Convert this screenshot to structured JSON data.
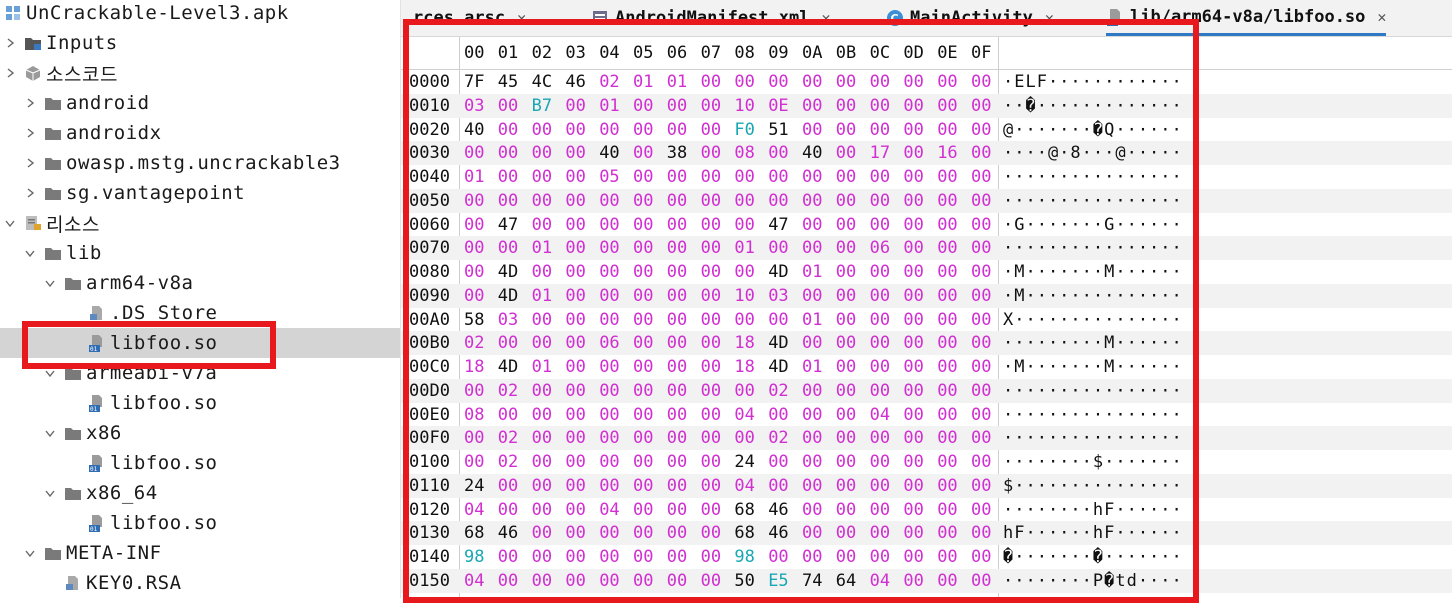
{
  "tree": {
    "items": [
      {
        "label": "UnCrackable-Level3.apk",
        "depth": 0,
        "chevron": "none",
        "icon": "apk-icon",
        "selected": false
      },
      {
        "label": "Inputs",
        "depth": 0,
        "chevron": "right",
        "icon": "inputs-folder-icon",
        "selected": false
      },
      {
        "label": "소스코드",
        "depth": 0,
        "chevron": "right",
        "icon": "source-package-icon",
        "selected": false
      },
      {
        "label": "android",
        "depth": 1,
        "chevron": "right",
        "icon": "package-folder-icon",
        "selected": false
      },
      {
        "label": "androidx",
        "depth": 1,
        "chevron": "right",
        "icon": "package-folder-icon",
        "selected": false
      },
      {
        "label": "owasp.mstg.uncrackable3",
        "depth": 1,
        "chevron": "right",
        "icon": "package-folder-icon",
        "selected": false
      },
      {
        "label": "sg.vantagepoint",
        "depth": 1,
        "chevron": "right",
        "icon": "package-folder-icon",
        "selected": false
      },
      {
        "label": "리소스",
        "depth": 0,
        "chevron": "down",
        "icon": "resources-icon",
        "selected": false
      },
      {
        "label": "lib",
        "depth": 1,
        "chevron": "down",
        "icon": "folder-icon",
        "selected": false
      },
      {
        "label": "arm64-v8a",
        "depth": 2,
        "chevron": "down",
        "icon": "folder-icon",
        "selected": false
      },
      {
        "label": ".DS_Store",
        "depth": 3,
        "chevron": "none",
        "icon": "file-icon",
        "selected": false
      },
      {
        "label": "libfoo.so",
        "depth": 3,
        "chevron": "none",
        "icon": "binary-file-icon",
        "selected": true
      },
      {
        "label": "armeabi-v7a",
        "depth": 2,
        "chevron": "down",
        "icon": "folder-icon",
        "selected": false
      },
      {
        "label": "libfoo.so",
        "depth": 3,
        "chevron": "none",
        "icon": "binary-file-icon",
        "selected": false
      },
      {
        "label": "x86",
        "depth": 2,
        "chevron": "down",
        "icon": "folder-icon",
        "selected": false
      },
      {
        "label": "libfoo.so",
        "depth": 3,
        "chevron": "none",
        "icon": "binary-file-icon",
        "selected": false
      },
      {
        "label": "x86_64",
        "depth": 2,
        "chevron": "down",
        "icon": "folder-icon",
        "selected": false
      },
      {
        "label": "libfoo.so",
        "depth": 3,
        "chevron": "none",
        "icon": "binary-file-icon",
        "selected": false
      },
      {
        "label": "META-INF",
        "depth": 1,
        "chevron": "down",
        "icon": "folder-icon",
        "selected": false
      },
      {
        "label": "KEY0.RSA",
        "depth": 2,
        "chevron": "none",
        "icon": "file-icon",
        "selected": false
      }
    ]
  },
  "tabs": [
    {
      "label": "rces.arsc",
      "icon": "",
      "closable": true,
      "active": false
    },
    {
      "label": "AndroidManifest.xml",
      "icon": "xml-file-icon",
      "closable": true,
      "active": false
    },
    {
      "label": "MainActivity",
      "icon": "class-icon",
      "closable": true,
      "active": false
    },
    {
      "label": "lib/arm64-v8a/libfoo.so",
      "icon": "binary-file-icon",
      "closable": true,
      "active": true
    }
  ],
  "hex": {
    "columns": [
      "00",
      "01",
      "02",
      "03",
      "04",
      "05",
      "06",
      "07",
      "08",
      "09",
      "0A",
      "0B",
      "0C",
      "0D",
      "0E",
      "0F"
    ],
    "rows": [
      {
        "addr": "0000",
        "bytes": [
          "7F",
          "45",
          "4C",
          "46",
          "02",
          "01",
          "01",
          "00",
          "00",
          "00",
          "00",
          "00",
          "00",
          "00",
          "00",
          "00"
        ],
        "ascii": "·ELF············"
      },
      {
        "addr": "0010",
        "bytes": [
          "03",
          "00",
          "B7",
          "00",
          "01",
          "00",
          "00",
          "00",
          "10",
          "0E",
          "00",
          "00",
          "00",
          "00",
          "00",
          "00"
        ],
        "ascii": "··�·············"
      },
      {
        "addr": "0020",
        "bytes": [
          "40",
          "00",
          "00",
          "00",
          "00",
          "00",
          "00",
          "00",
          "F0",
          "51",
          "00",
          "00",
          "00",
          "00",
          "00",
          "00"
        ],
        "ascii": "@·······�Q······"
      },
      {
        "addr": "0030",
        "bytes": [
          "00",
          "00",
          "00",
          "00",
          "40",
          "00",
          "38",
          "00",
          "08",
          "00",
          "40",
          "00",
          "17",
          "00",
          "16",
          "00"
        ],
        "ascii": "····@·8···@·····"
      },
      {
        "addr": "0040",
        "bytes": [
          "01",
          "00",
          "00",
          "00",
          "05",
          "00",
          "00",
          "00",
          "00",
          "00",
          "00",
          "00",
          "00",
          "00",
          "00",
          "00"
        ],
        "ascii": "················"
      },
      {
        "addr": "0050",
        "bytes": [
          "00",
          "00",
          "00",
          "00",
          "00",
          "00",
          "00",
          "00",
          "00",
          "00",
          "00",
          "00",
          "00",
          "00",
          "00",
          "00"
        ],
        "ascii": "················"
      },
      {
        "addr": "0060",
        "bytes": [
          "00",
          "47",
          "00",
          "00",
          "00",
          "00",
          "00",
          "00",
          "00",
          "47",
          "00",
          "00",
          "00",
          "00",
          "00",
          "00"
        ],
        "ascii": "·G·······G······"
      },
      {
        "addr": "0070",
        "bytes": [
          "00",
          "00",
          "01",
          "00",
          "00",
          "00",
          "00",
          "00",
          "01",
          "00",
          "00",
          "00",
          "06",
          "00",
          "00",
          "00"
        ],
        "ascii": "················"
      },
      {
        "addr": "0080",
        "bytes": [
          "00",
          "4D",
          "00",
          "00",
          "00",
          "00",
          "00",
          "00",
          "00",
          "4D",
          "01",
          "00",
          "00",
          "00",
          "00",
          "00"
        ],
        "ascii": "·M·······M······"
      },
      {
        "addr": "0090",
        "bytes": [
          "00",
          "4D",
          "01",
          "00",
          "00",
          "00",
          "00",
          "00",
          "10",
          "03",
          "00",
          "00",
          "00",
          "00",
          "00",
          "00"
        ],
        "ascii": "·M··············"
      },
      {
        "addr": "00A0",
        "bytes": [
          "58",
          "03",
          "00",
          "00",
          "00",
          "00",
          "00",
          "00",
          "00",
          "00",
          "01",
          "00",
          "00",
          "00",
          "00",
          "00"
        ],
        "ascii": "X···············"
      },
      {
        "addr": "00B0",
        "bytes": [
          "02",
          "00",
          "00",
          "00",
          "06",
          "00",
          "00",
          "00",
          "18",
          "4D",
          "00",
          "00",
          "00",
          "00",
          "00",
          "00"
        ],
        "ascii": "·········M······"
      },
      {
        "addr": "00C0",
        "bytes": [
          "18",
          "4D",
          "01",
          "00",
          "00",
          "00",
          "00",
          "00",
          "18",
          "4D",
          "01",
          "00",
          "00",
          "00",
          "00",
          "00"
        ],
        "ascii": "·M·······M······"
      },
      {
        "addr": "00D0",
        "bytes": [
          "00",
          "02",
          "00",
          "00",
          "00",
          "00",
          "00",
          "00",
          "00",
          "02",
          "00",
          "00",
          "00",
          "00",
          "00",
          "00"
        ],
        "ascii": "················"
      },
      {
        "addr": "00E0",
        "bytes": [
          "08",
          "00",
          "00",
          "00",
          "00",
          "00",
          "00",
          "00",
          "04",
          "00",
          "00",
          "00",
          "04",
          "00",
          "00",
          "00"
        ],
        "ascii": "················"
      },
      {
        "addr": "00F0",
        "bytes": [
          "00",
          "02",
          "00",
          "00",
          "00",
          "00",
          "00",
          "00",
          "00",
          "02",
          "00",
          "00",
          "00",
          "00",
          "00",
          "00"
        ],
        "ascii": "················"
      },
      {
        "addr": "0100",
        "bytes": [
          "00",
          "02",
          "00",
          "00",
          "00",
          "00",
          "00",
          "00",
          "24",
          "00",
          "00",
          "00",
          "00",
          "00",
          "00",
          "00"
        ],
        "ascii": "········$·······"
      },
      {
        "addr": "0110",
        "bytes": [
          "24",
          "00",
          "00",
          "00",
          "00",
          "00",
          "00",
          "00",
          "04",
          "00",
          "00",
          "00",
          "00",
          "00",
          "00",
          "00"
        ],
        "ascii": "$···············"
      },
      {
        "addr": "0120",
        "bytes": [
          "04",
          "00",
          "00",
          "00",
          "04",
          "00",
          "00",
          "00",
          "68",
          "46",
          "00",
          "00",
          "00",
          "00",
          "00",
          "00"
        ],
        "ascii": "········hF······"
      },
      {
        "addr": "0130",
        "bytes": [
          "68",
          "46",
          "00",
          "00",
          "00",
          "00",
          "00",
          "00",
          "68",
          "46",
          "00",
          "00",
          "00",
          "00",
          "00",
          "00"
        ],
        "ascii": "hF······hF······"
      },
      {
        "addr": "0140",
        "bytes": [
          "98",
          "00",
          "00",
          "00",
          "00",
          "00",
          "00",
          "00",
          "98",
          "00",
          "00",
          "00",
          "00",
          "00",
          "00",
          "00"
        ],
        "ascii": "�·······�·······"
      },
      {
        "addr": "0150",
        "bytes": [
          "04",
          "00",
          "00",
          "00",
          "00",
          "00",
          "00",
          "00",
          "50",
          "E5",
          "74",
          "64",
          "04",
          "00",
          "00",
          "00"
        ],
        "ascii": "········P�td····"
      }
    ]
  },
  "colors": {
    "zero_byte": "#d12fd1",
    "high_byte": "#1aa7b5",
    "normal_byte": "#111111",
    "highlight_box": "#e8191d",
    "tab_active_underline": "#2f78c4",
    "selection": "#d4d4d4"
  }
}
